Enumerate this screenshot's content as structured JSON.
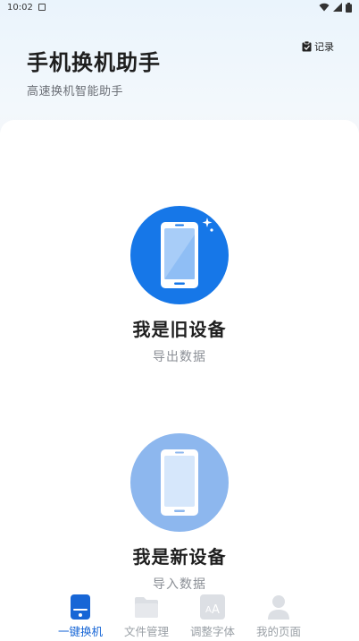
{
  "status_bar": {
    "time": "10:02"
  },
  "header": {
    "title": "手机换机助手",
    "subtitle": "高速换机智能助手",
    "record_label": "记录"
  },
  "options": {
    "old_device": {
      "title": "我是旧设备",
      "subtitle": "导出数据"
    },
    "new_device": {
      "title": "我是新设备",
      "subtitle": "导入数据"
    }
  },
  "tabbar": {
    "tabs": [
      {
        "label": "一键换机",
        "icon": "phone-icon",
        "active": true
      },
      {
        "label": "文件管理",
        "icon": "folder-icon",
        "active": false
      },
      {
        "label": "调整字体",
        "icon": "font-size-icon",
        "active": false
      },
      {
        "label": "我的页面",
        "icon": "user-icon",
        "active": false
      }
    ]
  },
  "colors": {
    "accent": "#1677e8",
    "accent_light": "#8db7ee",
    "tab_active": "#1766d6",
    "tab_inactive": "#9aa0a6"
  }
}
